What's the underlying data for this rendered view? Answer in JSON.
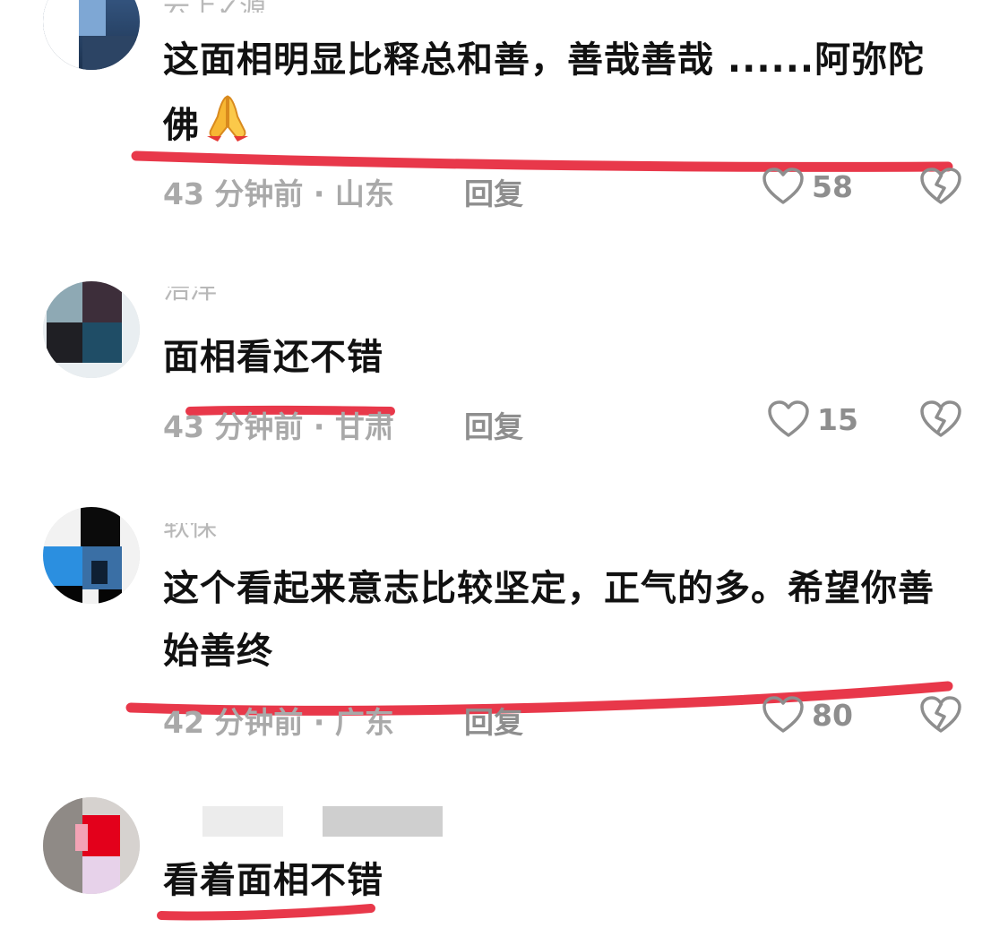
{
  "colors": {
    "text_primary": "#111111",
    "text_meta": "#a9a9a9",
    "icon_gray": "#8e8e8e",
    "highlight_red": "#e8384a"
  },
  "comments": [
    {
      "username": "云上✓源",
      "text": "这面相明显比释总和善，善哉善哉 ......阿弥陀佛",
      "emoji": "folded-hands",
      "time": "43 分钟前 · 山东",
      "reply_label": "回复",
      "likes": "58"
    },
    {
      "username": "浩洋",
      "text": "面相看还不错",
      "time": "43 分钟前 · 甘肃",
      "reply_label": "回复",
      "likes": "15"
    },
    {
      "username": "软保",
      "text": "这个看起来意志比较坚定，正气的多。希望你善始善终",
      "time": "42 分钟前 · 广东",
      "reply_label": "回复",
      "likes": "80"
    },
    {
      "username": "",
      "text": "看着面相不错"
    }
  ]
}
